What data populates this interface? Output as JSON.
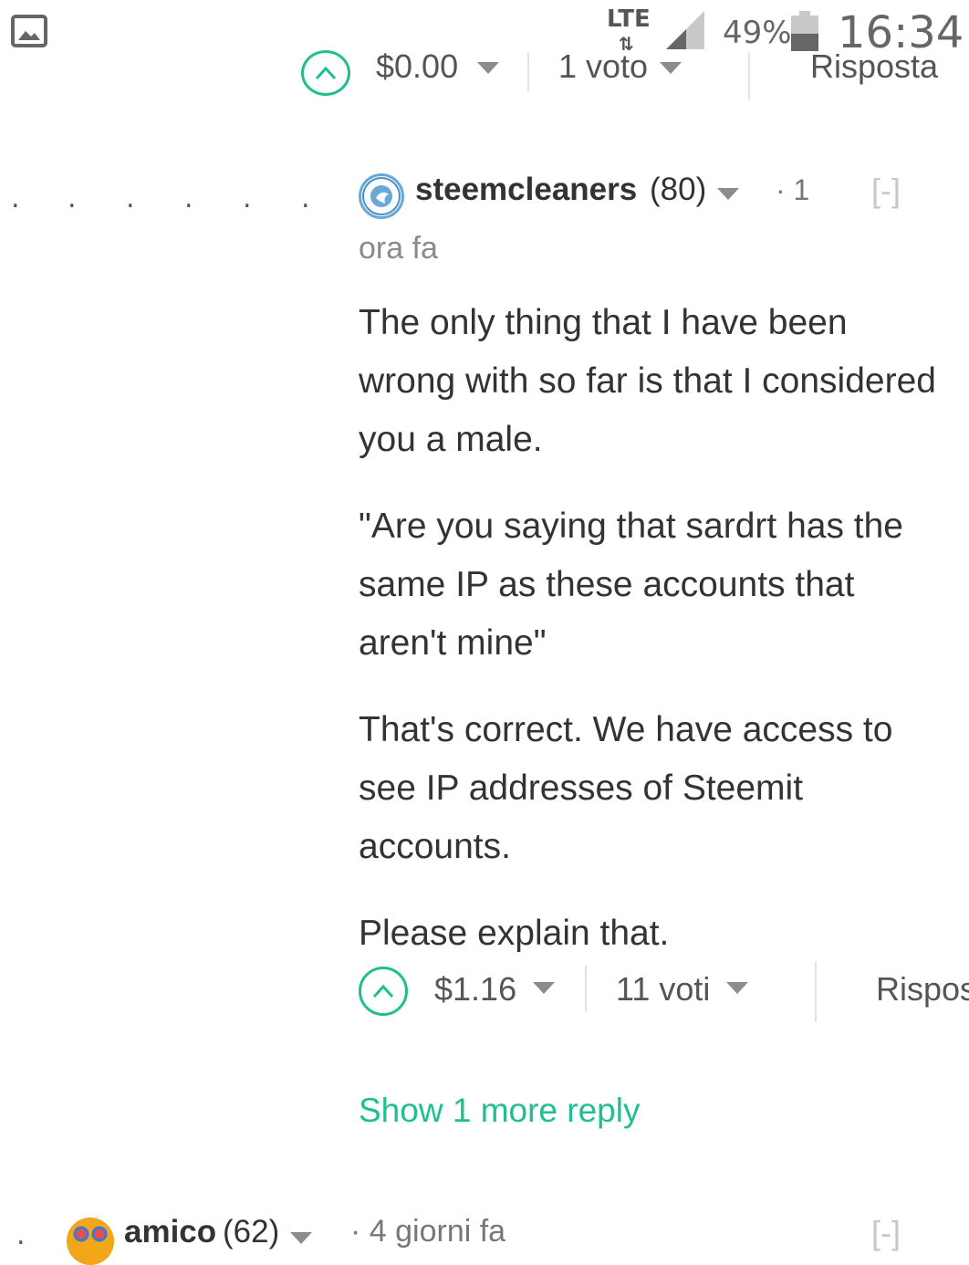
{
  "status_bar": {
    "network": "LTE",
    "network_arrows": "⇅",
    "battery_percent": "49%",
    "battery_level": 0.49,
    "time": "16:34"
  },
  "previous_comment_footer": {
    "payout": "$0.00",
    "votes": "1 voto",
    "reply": "Risposta"
  },
  "comment": {
    "author": "steemcleaners",
    "reputation": "(80)",
    "separator_dot": "·",
    "vote_count_badge": "1",
    "collapse": "[-]",
    "time": "ora fa",
    "paragraphs": [
      "The only thing that I have been wrong with so far is that I considered you a male.",
      "\"Are you saying that sardrt has the same IP as these accounts that aren't mine\"",
      "That's correct. We have access to see IP addresses of Steemit accounts.",
      "Please explain that."
    ],
    "footer": {
      "payout": "$1.16",
      "votes": "11 voti",
      "reply": "Risposta"
    },
    "show_more": "Show 1 more reply"
  },
  "next_comment": {
    "author": "amico",
    "reputation": "(62)",
    "time": "· 4 giorni fa",
    "collapse": "[-]"
  },
  "colors": {
    "accent": "#1fbf8f",
    "text": "#333333",
    "muted": "#8a8a8a"
  }
}
